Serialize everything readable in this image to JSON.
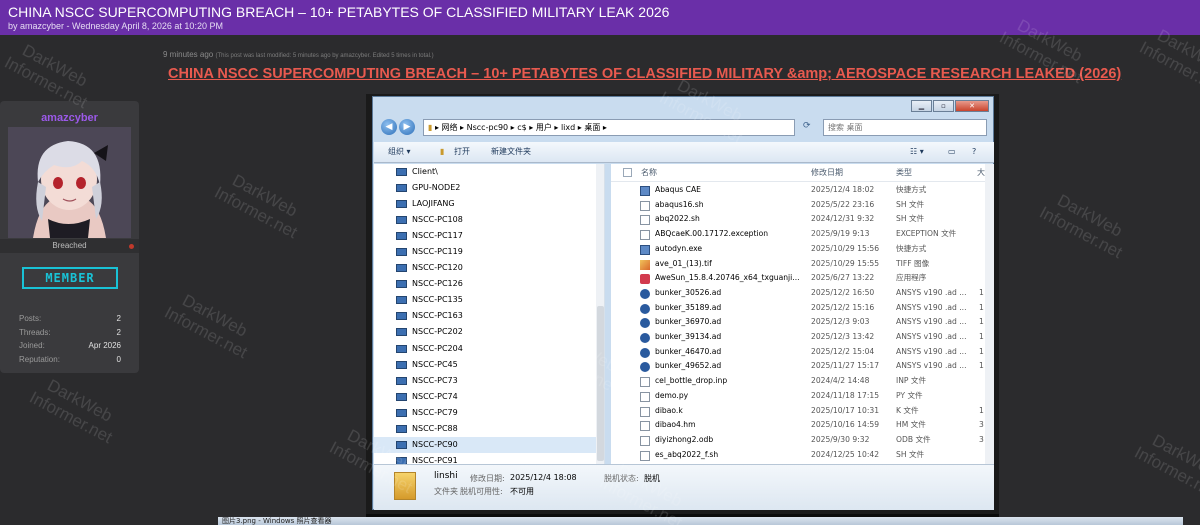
{
  "topbar": {
    "title": "CHINA NSCC SUPERCOMPUTING BREACH – 10+ PETABYTES OF CLASSIFIED MILITARY LEAK 2026",
    "byline": "by amazcyber - Wednesday April 8, 2026 at 10:20 PM"
  },
  "post": {
    "time": "9 minutes ago",
    "edit_note": "(This post was last modified: 5 minutes ago by amazcyber. Edited 5 times in total.)",
    "title": "CHINA NSCC SUPERCOMPUTING BREACH – 10+ PETABYTES OF CLASSIFIED MILITARY &amp; AEROSPACE RESEARCH LEAKED (2026)"
  },
  "profile": {
    "username": "amazcyber",
    "status": "Breached",
    "rank": "MEMBER",
    "stats": [
      {
        "label": "Posts:",
        "value": "2"
      },
      {
        "label": "Threads:",
        "value": "2"
      },
      {
        "label": "Joined:",
        "value": "Apr 2026"
      },
      {
        "label": "Reputation:",
        "value": "0"
      }
    ]
  },
  "watermark": "DarkWeb Informer.net",
  "explorer": {
    "address": [
      "网络",
      "Nscc-pc90",
      "c$",
      "用户",
      "lixd",
      "桌面"
    ],
    "search_placeholder": "搜索 桌面",
    "toolbar": {
      "organize": "组织 ▾",
      "open": "打开",
      "new_folder": "新建文件夹"
    },
    "nav_items": [
      "Client\\",
      "GPU-NODE2",
      "LAOJIFANG",
      "NSCC-PC108",
      "NSCC-PC117",
      "NSCC-PC119",
      "NSCC-PC120",
      "NSCC-PC126",
      "NSCC-PC135",
      "NSCC-PC163",
      "NSCC-PC202",
      "NSCC-PC204",
      "NSCC-PC45",
      "NSCC-PC73",
      "NSCC-PC74",
      "NSCC-PC79",
      "NSCC-PC88",
      "NSCC-PC90",
      "NSCC-PC91"
    ],
    "nav_selected": 17,
    "columns": {
      "name": "名称",
      "date": "修改日期",
      "type": "类型",
      "extra": "大"
    },
    "files": [
      {
        "name": "Abaqus CAE",
        "date": "2025/12/4 18:02",
        "type": "快捷方式",
        "extra": "",
        "icon": "app"
      },
      {
        "name": "abaqus16.sh",
        "date": "2025/5/22 23:16",
        "type": "SH 文件",
        "extra": "",
        "icon": "doc"
      },
      {
        "name": "abq2022.sh",
        "date": "2024/12/31 9:32",
        "type": "SH 文件",
        "extra": "",
        "icon": "doc"
      },
      {
        "name": "ABQcaeK.00.17172.exception",
        "date": "2025/9/19 9:13",
        "type": "EXCEPTION 文件",
        "extra": "",
        "icon": "doc"
      },
      {
        "name": "autodyn.exe",
        "date": "2025/10/29 15:56",
        "type": "快捷方式",
        "extra": "",
        "icon": "app"
      },
      {
        "name": "ave_01_(13).tif",
        "date": "2025/10/29 15:55",
        "type": "TIFF 图像",
        "extra": "",
        "icon": "img"
      },
      {
        "name": "AweSun_15.8.4.20746_x64_txguanji...",
        "date": "2025/6/27 13:22",
        "type": "应用程序",
        "extra": "",
        "icon": "awe"
      },
      {
        "name": "bunker_30526.ad",
        "date": "2025/12/2 16:50",
        "type": "ANSYS v190 .ad ...",
        "extra": "1",
        "icon": "ad"
      },
      {
        "name": "bunker_35189.ad",
        "date": "2025/12/2 15:16",
        "type": "ANSYS v190 .ad ...",
        "extra": "1",
        "icon": "ad"
      },
      {
        "name": "bunker_36970.ad",
        "date": "2025/12/3 9:03",
        "type": "ANSYS v190 .ad ...",
        "extra": "1",
        "icon": "ad"
      },
      {
        "name": "bunker_39134.ad",
        "date": "2025/12/3 13:42",
        "type": "ANSYS v190 .ad ...",
        "extra": "1",
        "icon": "ad"
      },
      {
        "name": "bunker_46470.ad",
        "date": "2025/12/2 15:04",
        "type": "ANSYS v190 .ad ...",
        "extra": "1",
        "icon": "ad"
      },
      {
        "name": "bunker_49652.ad",
        "date": "2025/11/27 15:17",
        "type": "ANSYS v190 .ad ...",
        "extra": "1",
        "icon": "ad"
      },
      {
        "name": "cel_bottle_drop.inp",
        "date": "2024/4/2 14:48",
        "type": "INP 文件",
        "extra": "",
        "icon": "doc"
      },
      {
        "name": "demo.py",
        "date": "2024/11/18 17:15",
        "type": "PY 文件",
        "extra": "",
        "icon": "doc"
      },
      {
        "name": "dibao.k",
        "date": "2025/10/17 10:31",
        "type": "K 文件",
        "extra": "1",
        "icon": "doc"
      },
      {
        "name": "dibao4.hm",
        "date": "2025/10/16 14:59",
        "type": "HM 文件",
        "extra": "3",
        "icon": "doc"
      },
      {
        "name": "diyizhong2.odb",
        "date": "2025/9/30 9:32",
        "type": "ODB 文件",
        "extra": "3",
        "icon": "doc"
      },
      {
        "name": "es_abq2022_f.sh",
        "date": "2024/12/25 10:42",
        "type": "SH 文件",
        "extra": "",
        "icon": "doc"
      }
    ],
    "details": {
      "name": "linshi",
      "modified_label": "修改日期:",
      "modified_value": "2025/12/4 18:08",
      "type": "文件夹",
      "offline_label": "脱机状态:",
      "offline_value": "脱机",
      "avail_label": "脱机可用性:",
      "avail_value": "不可用"
    }
  },
  "bottom_strip": "图片3.png - Windows 照片查看器"
}
